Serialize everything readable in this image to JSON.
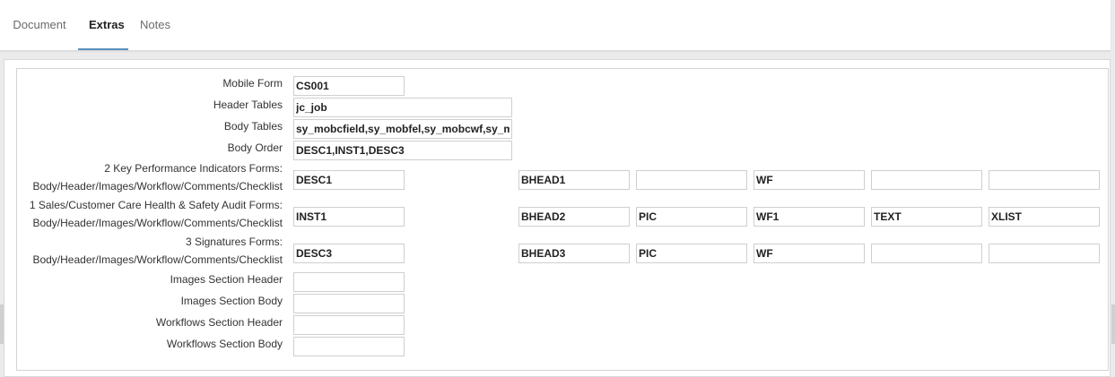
{
  "tabs": [
    {
      "label": "Document"
    },
    {
      "label": "Extras"
    },
    {
      "label": "Notes"
    }
  ],
  "form": {
    "mobile_form": {
      "label": "Mobile Form",
      "value": "CS001"
    },
    "header_tables": {
      "label": "Header Tables",
      "value": "jc_job"
    },
    "body_tables": {
      "label": "Body Tables",
      "value": "sy_mobcfield,sy_mobfel,sy_mobcwf,sy_mobf"
    },
    "body_order": {
      "label": "Body Order",
      "value": "DESC1,INST1,DESC3"
    },
    "groups": [
      {
        "label1": "2 Key Performance Indicators Forms:",
        "label2": "Body/Header/Images/Workflow/Comments/Checklist",
        "values": [
          "DESC1",
          "BHEAD1",
          "",
          "WF",
          "",
          ""
        ]
      },
      {
        "label1": "1 Sales/Customer Care Health & Safety Audit Forms:",
        "label2": "Body/Header/Images/Workflow/Comments/Checklist",
        "values": [
          "INST1",
          "BHEAD2",
          "PIC",
          "WF1",
          "TEXT",
          "XLIST"
        ]
      },
      {
        "label1": "3 Signatures Forms:",
        "label2": "Body/Header/Images/Workflow/Comments/Checklist",
        "values": [
          "DESC3",
          "BHEAD3",
          "PIC",
          "WF",
          "",
          ""
        ]
      }
    ],
    "images_section_header": {
      "label": "Images Section Header",
      "value": ""
    },
    "images_section_body": {
      "label": "Images Section Body",
      "value": ""
    },
    "workflows_section_header": {
      "label": "Workflows Section Header",
      "value": ""
    },
    "workflows_section_body": {
      "label": "Workflows Section Body",
      "value": ""
    }
  }
}
